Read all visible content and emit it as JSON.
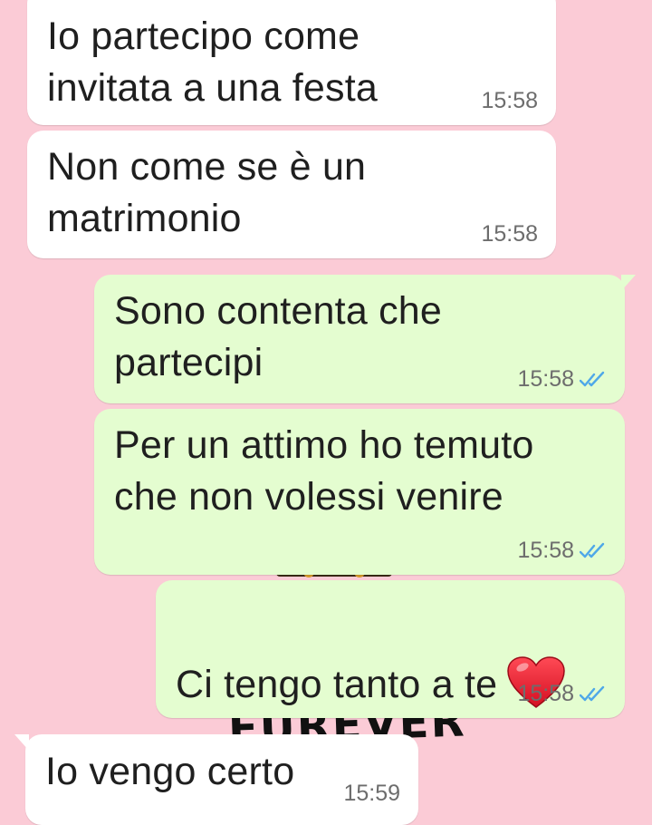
{
  "messages": [
    {
      "direction": "incoming",
      "text": "Io partecipo come\ninvitata a una festa",
      "time": "15:58"
    },
    {
      "direction": "incoming",
      "text": "Non come se è un\nmatrimonio",
      "time": "15:58"
    },
    {
      "direction": "outgoing",
      "text": "Sono contenta che\npartecipi",
      "time": "15:58",
      "status": "read"
    },
    {
      "direction": "outgoing",
      "text": "Per un attimo ho temuto\nche non volessi venire",
      "time": "15:58",
      "status": "read"
    },
    {
      "direction": "outgoing",
      "text": "Ci tengo tanto a te",
      "emoji": "red-heart",
      "time": "15:58",
      "status": "read"
    },
    {
      "direction": "incoming",
      "text": "Io vengo certo",
      "time": "15:59"
    }
  ],
  "wallpaper": {
    "text_fragment": "FUREVER"
  },
  "colors": {
    "background": "#fbcbd6",
    "incoming_bubble": "#ffffff",
    "outgoing_bubble": "#e4fdd0",
    "read_ticks": "#4fa8e8",
    "heart": "#e8182c"
  },
  "icons": {
    "read_status": "double-check-icon",
    "emoji": "red-heart-emoji"
  }
}
